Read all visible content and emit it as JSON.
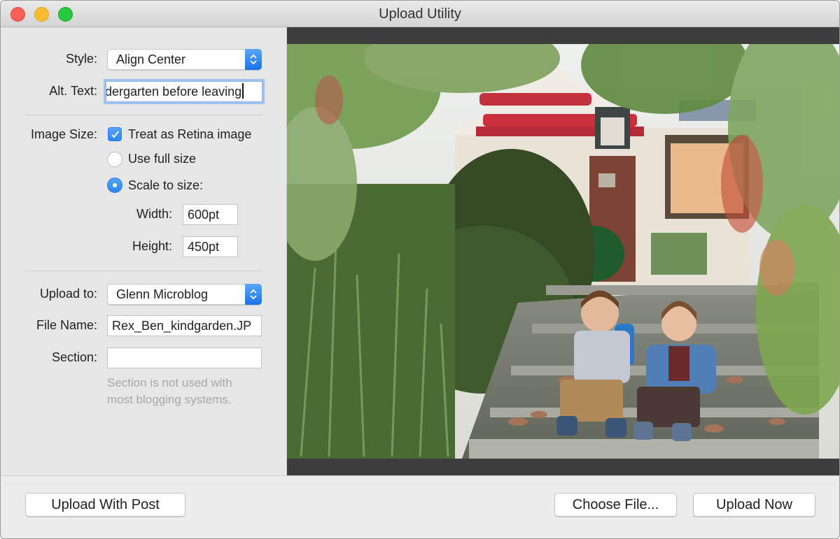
{
  "window": {
    "title": "Upload Utility",
    "controls": [
      "close",
      "minimize",
      "zoom"
    ]
  },
  "form": {
    "style": {
      "label": "Style:",
      "value": "Align Center"
    },
    "alt_text": {
      "label": "Alt. Text:",
      "value": "dergarten before leaving"
    },
    "image_size": {
      "label": "Image Size:",
      "retina": {
        "label": "Treat as Retina image",
        "checked": true
      },
      "options": [
        {
          "label": "Use full size",
          "selected": false
        },
        {
          "label": "Scale to size:",
          "selected": true
        }
      ],
      "width": {
        "label": "Width:",
        "value": "600pt"
      },
      "height": {
        "label": "Height:",
        "value": "450pt"
      }
    },
    "upload_to": {
      "label": "Upload to:",
      "value": "Glenn Microblog"
    },
    "file_name": {
      "label": "File Name:",
      "value": "Rex_Ben_kindgarden.JP"
    },
    "section": {
      "label": "Section:",
      "value": "",
      "hint_line1": "Section is not used with",
      "hint_line2": "most blogging systems."
    }
  },
  "preview": {
    "description": "Photo of two laughing boys sitting on mossy concrete steps in front of a craftsman house with red beams, surrounded by green shrubs and autumn leaves"
  },
  "buttons": {
    "upload_with_post": "Upload With Post",
    "choose_file": "Choose File...",
    "upload_now": "Upload Now"
  },
  "colors": {
    "accent": "#2d85f0",
    "close": "#fc5f57",
    "minimize": "#fdbc2e",
    "zoom": "#28c840",
    "preview_bg": "#3d3d3d"
  }
}
